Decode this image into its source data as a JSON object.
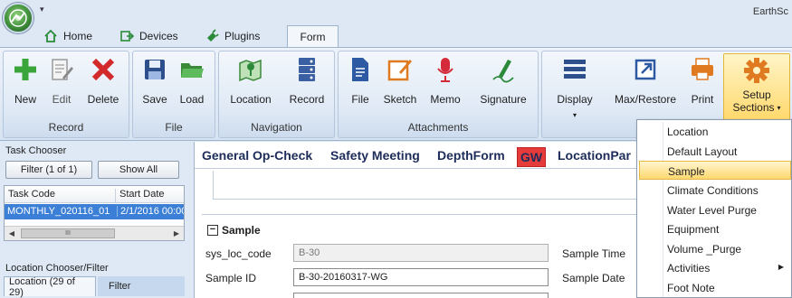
{
  "app": {
    "title": "EarthSc",
    "qat_glyph": "▾"
  },
  "tabs": [
    {
      "label": "Home"
    },
    {
      "label": "Devices"
    },
    {
      "label": "Plugins"
    },
    {
      "label": "Form"
    }
  ],
  "ribbon": {
    "groups": [
      {
        "label": "Record",
        "buttons": [
          {
            "label": "New"
          },
          {
            "label": "Edit"
          },
          {
            "label": "Delete"
          }
        ]
      },
      {
        "label": "File",
        "buttons": [
          {
            "label": "Save"
          },
          {
            "label": "Load"
          }
        ]
      },
      {
        "label": "Navigation",
        "buttons": [
          {
            "label": "Location"
          },
          {
            "label": "Record"
          }
        ]
      },
      {
        "label": "Attachments",
        "buttons": [
          {
            "label": "File"
          },
          {
            "label": "Sketch"
          },
          {
            "label": "Memo"
          },
          {
            "label": "Signature"
          }
        ]
      },
      {
        "label": "",
        "buttons": [
          {
            "label": "Display"
          },
          {
            "label": "Max/Restore"
          },
          {
            "label": "Print"
          },
          {
            "label_line1": "Setup",
            "label_line2": "Sections"
          }
        ]
      }
    ],
    "caret": "▾"
  },
  "task_chooser": {
    "title": "Task Chooser",
    "filter_button": "Filter (1 of 1)",
    "show_all_button": "Show All",
    "columns": [
      "Task Code",
      "Start Date"
    ],
    "rows": [
      {
        "task_code": "MONTHLY_020116_01",
        "start_date": "2/1/2016 00:00"
      }
    ],
    "scroll_thumb": "III"
  },
  "location_chooser": {
    "title": "Location Chooser/Filter",
    "tabs": [
      "Location (29 of 29)",
      "Filter"
    ]
  },
  "form": {
    "tabs": [
      "General Op-Check",
      "Safety Meeting",
      "DepthForm",
      "GW",
      "LocationPar"
    ],
    "section_title": "Sample",
    "section_toggle": "−",
    "fields": {
      "sys_loc_code_label": "sys_loc_code",
      "sys_loc_code_value": "B-30",
      "sample_id_label": "Sample ID",
      "sample_id_value": "B-30-20160317-WG",
      "sample_time_label": "Sample Time",
      "sample_date_label": "Sample Date"
    }
  },
  "setup_menu": {
    "items": [
      {
        "label": "Location"
      },
      {
        "label": "Default Layout"
      },
      {
        "label": "Sample"
      },
      {
        "label": "Climate Conditions"
      },
      {
        "label": "Water Level Purge"
      },
      {
        "label": "Equipment"
      },
      {
        "label": "Volume _Purge"
      },
      {
        "label": "Activities",
        "submenu": "▶"
      },
      {
        "label": "Foot Note"
      }
    ],
    "highlighted_item": "Sample"
  },
  "colors": {
    "accent": "#3c7fd6",
    "highlight": "#ffd86b",
    "gw_tab": "#e63b3b"
  }
}
